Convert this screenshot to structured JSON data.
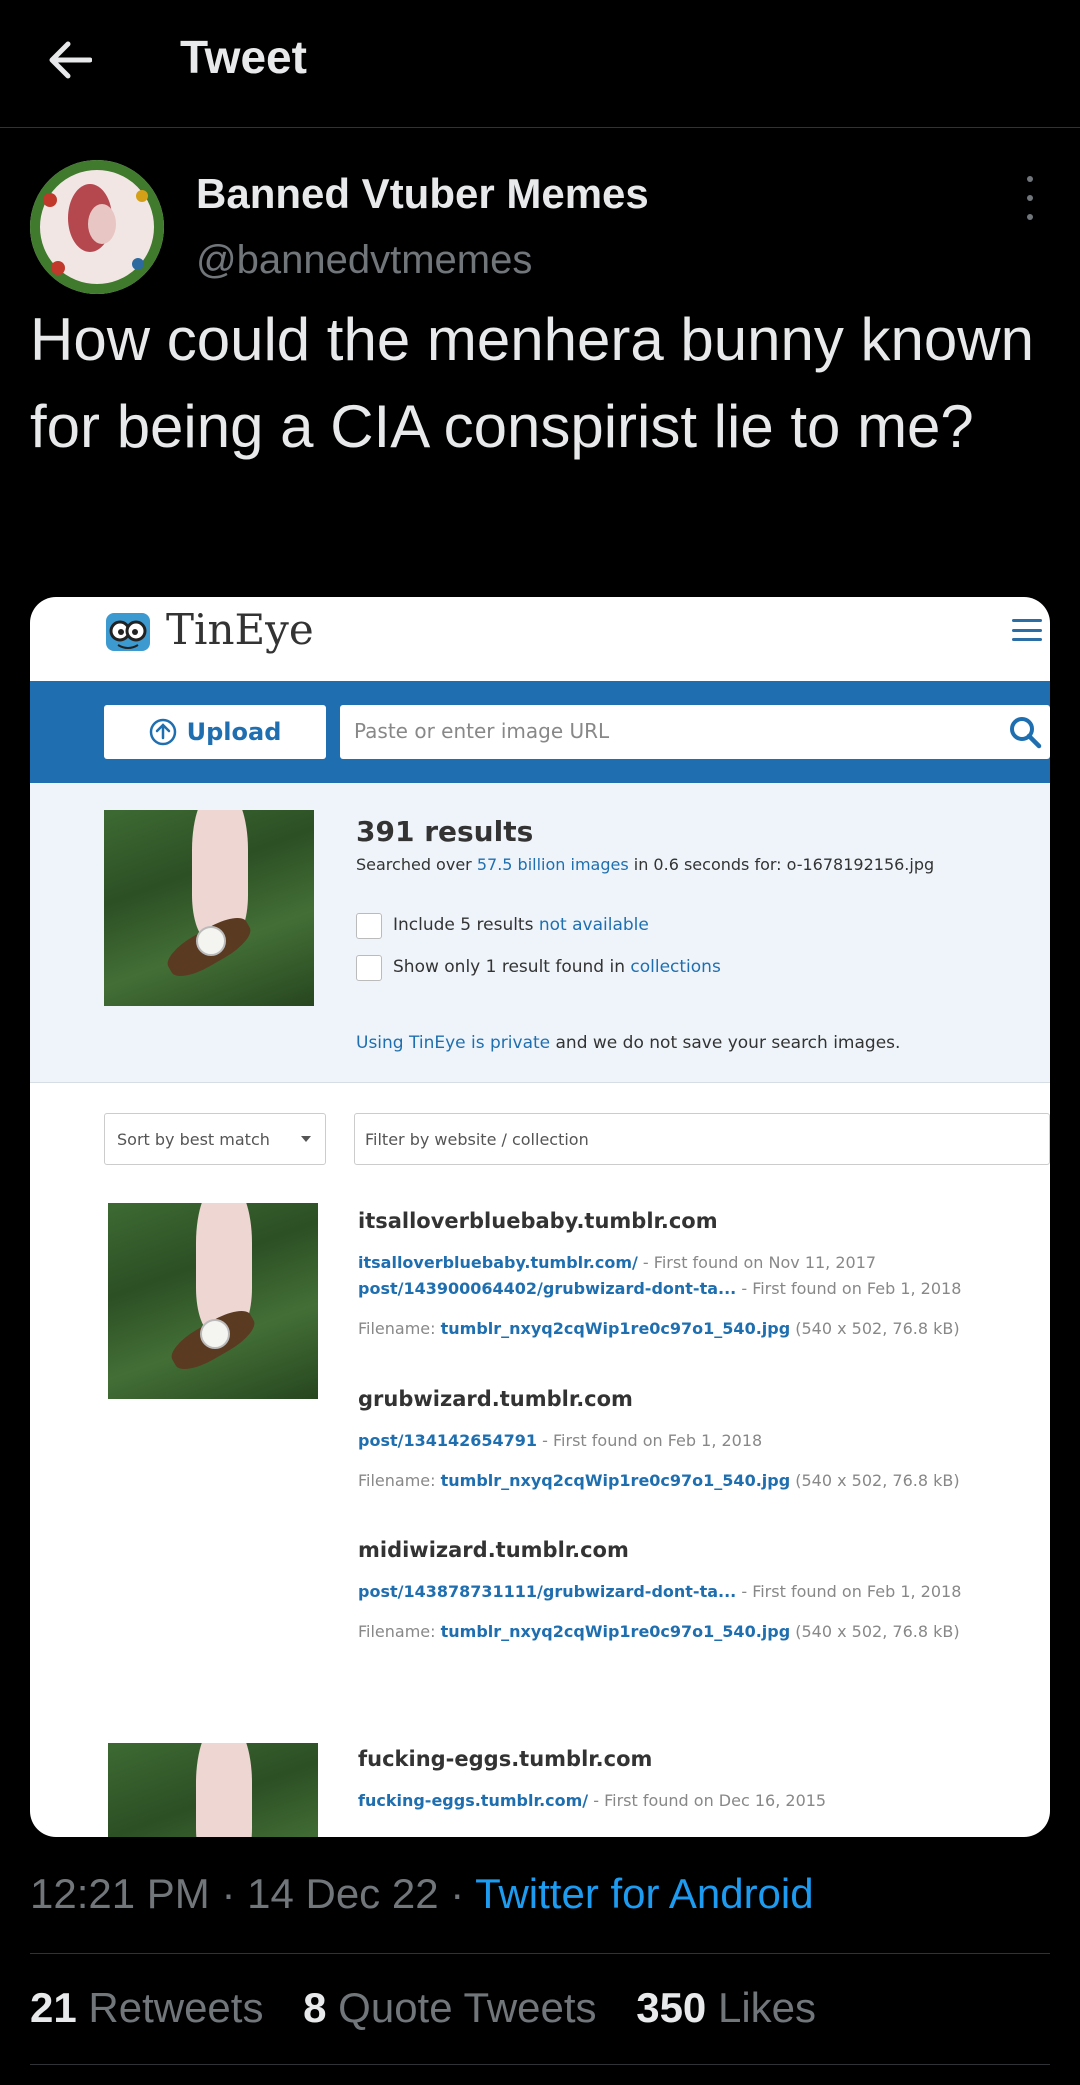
{
  "header": {
    "title": "Tweet"
  },
  "author": {
    "name": "Banned Vtuber Memes",
    "handle": "@bannedvtmemes"
  },
  "tweet": {
    "text": "How could the menhera bunny known for being a CIA conspirist lie to me?"
  },
  "tineye": {
    "logo": "TinEye",
    "upload_label": "Upload",
    "url_placeholder": "Paste or enter image URL",
    "results_count": "391 results",
    "searched_prefix": "Searched over ",
    "searched_link": "57.5 billion images",
    "searched_suffix": " in 0.6 seconds for: o-1678192156.jpg",
    "include_prefix": "Include 5 results ",
    "include_link": "not available",
    "show_prefix": "Show only 1 result found in ",
    "show_link": "collections",
    "private_link": "Using TinEye is private",
    "private_suffix": " and we do not save your search images.",
    "sort_label": "Sort by best match",
    "filter_placeholder": "Filter by website / collection",
    "results": [
      {
        "site": "itsalloverbluebaby.tumblr.com",
        "link1": "itsalloverbluebaby.tumblr.com/",
        "found1": " - First found on Nov 11, 2017",
        "link2": "post/143900064402/grubwizard-dont-ta...",
        "found2": " - First found on Feb 1, 2018",
        "filename_label": "Filename: ",
        "filename": "tumblr_nxyq2cqWip1re0c97o1_540.jpg",
        "meta": " (540 x 502, 76.8 kB)"
      },
      {
        "site": "grubwizard.tumblr.com",
        "link1": "post/134142654791",
        "found1": " - First found on Feb 1, 2018",
        "filename_label": "Filename: ",
        "filename": "tumblr_nxyq2cqWip1re0c97o1_540.jpg",
        "meta": " (540 x 502, 76.8 kB)"
      },
      {
        "site": "midiwizard.tumblr.com",
        "link1": "post/143878731111/grubwizard-dont-ta...",
        "found1": " - First found on Feb 1, 2018",
        "filename_label": "Filename: ",
        "filename": "tumblr_nxyq2cqWip1re0c97o1_540.jpg",
        "meta": " (540 x 502, 76.8 kB)"
      },
      {
        "site": "fucking-eggs.tumblr.com",
        "link1": "fucking-eggs.tumblr.com/",
        "found1": " - First found on Dec 16, 2015"
      }
    ]
  },
  "footer": {
    "time": "12:21 PM · 14 Dec 22 · ",
    "source": "Twitter for Android",
    "retweets_count": "21",
    "retweets_label": " Retweets",
    "quotes_count": "8",
    "quotes_label": " Quote Tweets",
    "likes_count": "350",
    "likes_label": " Likes"
  },
  "colors": {
    "link": "#1d9bf0",
    "tineye_blue": "#1f6fb0",
    "muted": "#71767b"
  },
  "icons": [
    "back-arrow-icon",
    "more-vertical-icon",
    "upload-icon",
    "search-icon",
    "menu-icon",
    "tineye-logo-icon"
  ]
}
